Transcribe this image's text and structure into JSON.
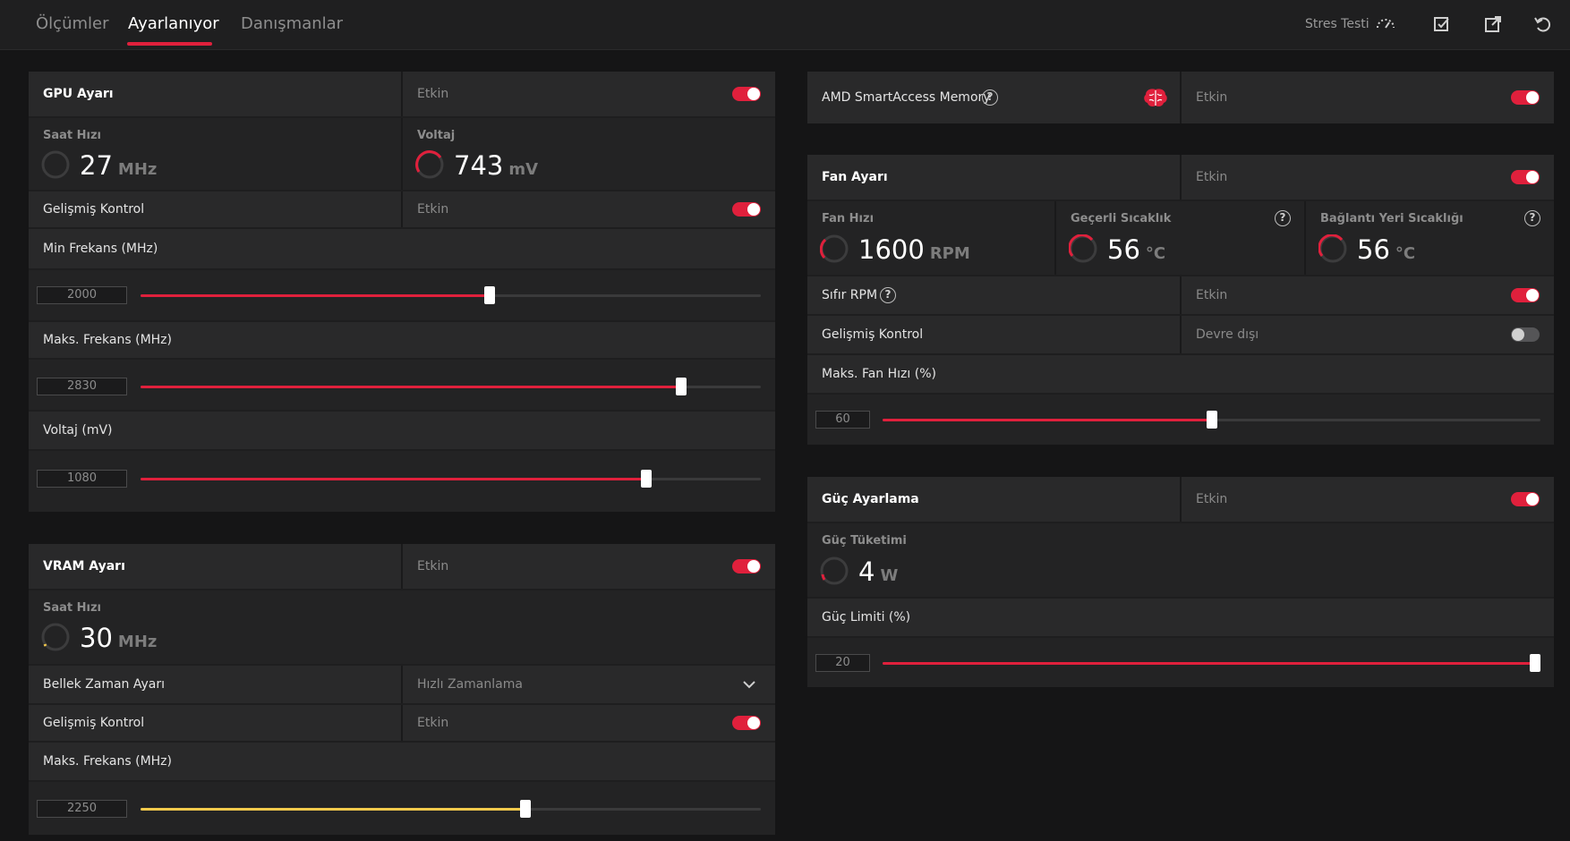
{
  "topbar": {
    "tabs": [
      {
        "label": "Ölçümler"
      },
      {
        "label": "Ayarlanıyor"
      },
      {
        "label": "Danışmanlar"
      }
    ],
    "stress_label": "Stres Testi",
    "accent": "#e0203c"
  },
  "gpu": {
    "title": "GPU Ayarı",
    "status": "Etkin",
    "clock": {
      "label": "Saat Hızı",
      "value": "27",
      "unit": "MHz"
    },
    "voltage": {
      "label": "Voltaj",
      "value": "743",
      "unit": "mV"
    },
    "advanced": {
      "label": "Gelişmiş Kontrol",
      "status": "Etkin"
    },
    "sliders": [
      {
        "label": "Min Frekans (MHz)",
        "value": "2000",
        "fraction": 0.563
      },
      {
        "label": "Maks. Frekans (MHz)",
        "value": "2830",
        "fraction": 0.872
      },
      {
        "label": "Voltaj (mV)",
        "value": "1080",
        "fraction": 0.815
      }
    ]
  },
  "vram": {
    "title": "VRAM Ayarı",
    "status": "Etkin",
    "clock": {
      "label": "Saat Hızı",
      "value": "30",
      "unit": "MHz"
    },
    "timing": {
      "label": "Bellek Zaman Ayarı",
      "value": "Hızlı Zamanlama"
    },
    "advanced": {
      "label": "Gelişmiş Kontrol",
      "status": "Etkin"
    },
    "slider": {
      "label": "Maks. Frekans (MHz)",
      "value": "2250",
      "fraction": 0.62
    }
  },
  "sam": {
    "title": "AMD SmartAccess Memory",
    "status": "Etkin"
  },
  "fan": {
    "title": "Fan Ayarı",
    "status": "Etkin",
    "speed": {
      "label": "Fan Hızı",
      "value": "1600",
      "unit": "RPM"
    },
    "temp": {
      "label": "Geçerli Sıcaklık",
      "value": "56",
      "unit": "°C"
    },
    "junction": {
      "label": "Bağlantı Yeri Sıcaklığı",
      "value": "56",
      "unit": "°C"
    },
    "zero_rpm": {
      "label": "Sıfır RPM",
      "status": "Etkin"
    },
    "advanced": {
      "label": "Gelişmiş Kontrol",
      "status": "Devre dışı"
    },
    "slider": {
      "label": "Maks. Fan Hızı (%)",
      "value": "60",
      "fraction": 0.5
    }
  },
  "power": {
    "title": "Güç Ayarlama",
    "status": "Etkin",
    "consumption": {
      "label": "Güç Tüketimi",
      "value": "4",
      "unit": "W"
    },
    "slider": {
      "label": "Güç Limiti (%)",
      "value": "20",
      "fraction": 1.0
    }
  }
}
